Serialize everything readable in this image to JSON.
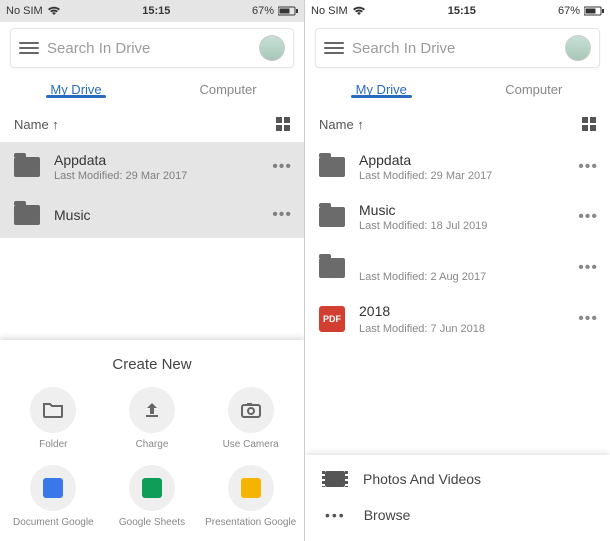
{
  "status": {
    "carrier": "No SIM",
    "time": "15:15",
    "battery": "67%"
  },
  "search": {
    "placeholder": "Search In Drive"
  },
  "tabs": {
    "mydrive": "My Drive",
    "computer": "Computer"
  },
  "sort": {
    "labelLeft": "Name ↑",
    "labelRight": "Name ↑"
  },
  "left": {
    "items": [
      {
        "title": "Appdata",
        "sub": "Last Modified: 29 Mar 2017"
      },
      {
        "title": "Music",
        "sub": ""
      }
    ],
    "sheet": {
      "title": "Create New",
      "cells": [
        {
          "label": "Folder"
        },
        {
          "label": "Charge"
        },
        {
          "label": "Use Camera"
        },
        {
          "label": "Document Google"
        },
        {
          "label": "Google Sheets"
        },
        {
          "label": "Presentation Google"
        }
      ]
    }
  },
  "right": {
    "items": [
      {
        "kind": "folder",
        "title": "Appdata",
        "sub": "Last Modified: 29 Mar 2017"
      },
      {
        "kind": "folder",
        "title": "Music",
        "sub": "Last Modified: 18 Jul 2019"
      },
      {
        "kind": "folder",
        "title": "",
        "sub": "Last Modified: 2 Aug 2017"
      },
      {
        "kind": "pdf",
        "title": "2018",
        "sub": "Last Modified: 7 Jun 2018"
      }
    ],
    "menu": {
      "photos": "Photos And Videos",
      "browse": "Browse"
    }
  },
  "pdfLabel": "PDF"
}
